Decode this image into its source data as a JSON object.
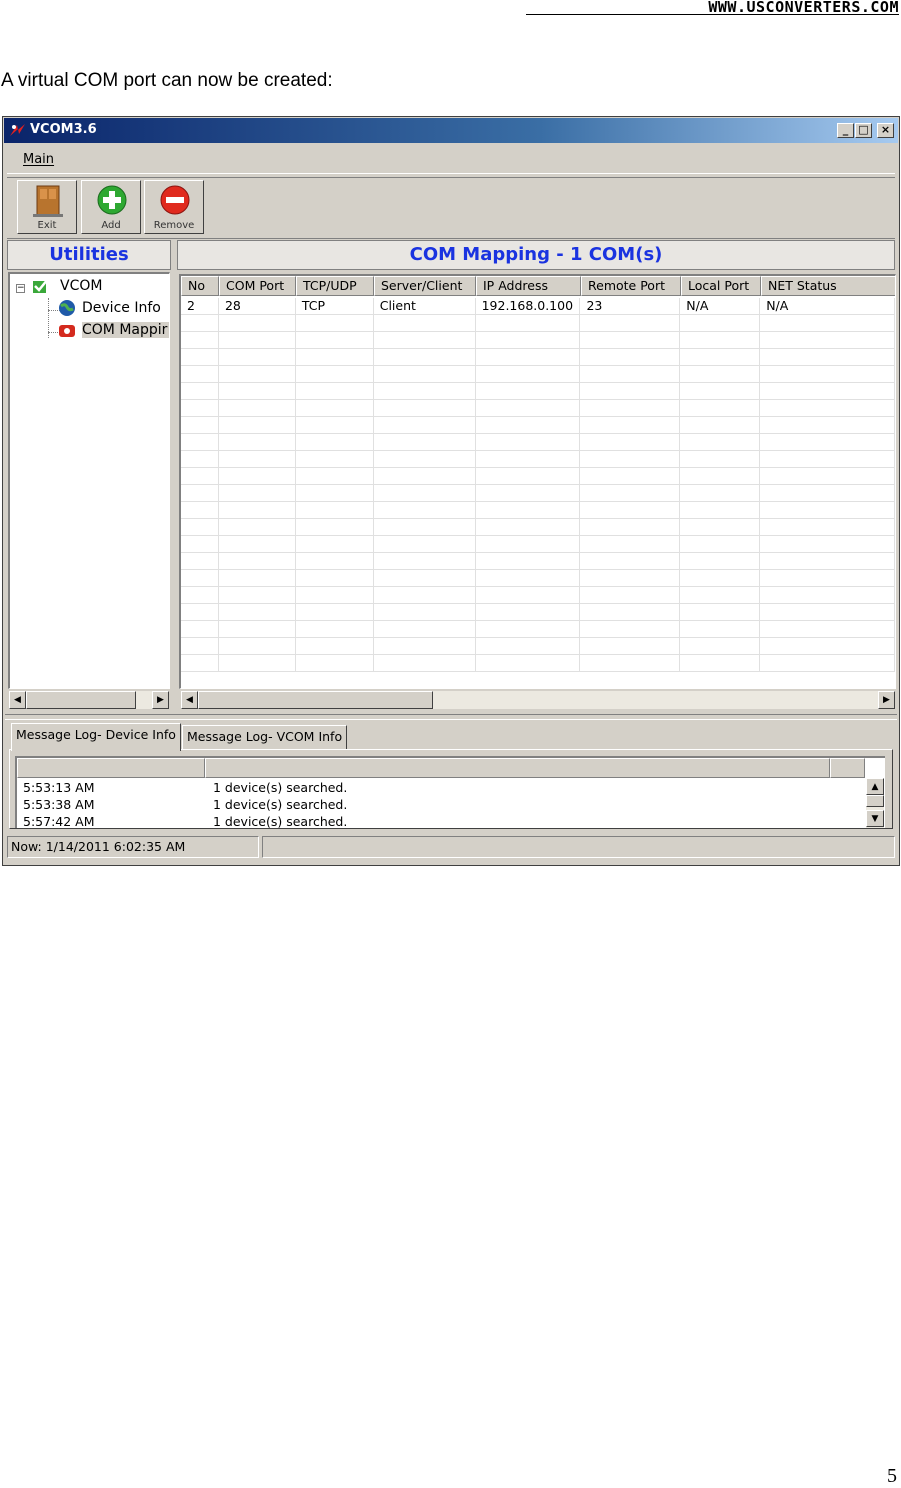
{
  "header": {
    "url": "WWW.USCONVERTERS.COM"
  },
  "intro_text": "A virtual COM port can now be created:",
  "window": {
    "title": "VCOM3.6",
    "title_buttons": {
      "minimize": "_",
      "maximize": "□",
      "close": "×"
    },
    "menu": {
      "main": "Main"
    },
    "toolbar": {
      "exit": "Exit",
      "add": "Add",
      "remove": "Remove"
    },
    "left_panel": {
      "title": "Utilities",
      "tree": {
        "root": "VCOM",
        "children": [
          "Device Info",
          "COM Mappir"
        ],
        "expander": "−"
      }
    },
    "right_panel": {
      "title": "COM Mapping - 1 COM(s)",
      "columns": [
        "No",
        "COM Port",
        "TCP/UDP",
        "Server/Client",
        "IP Address",
        "Remote Port",
        "Local Port",
        "NET Status"
      ],
      "rows": [
        [
          "2",
          "28",
          "TCP",
          "Client",
          "192.168.0.100",
          "23",
          "N/A",
          "N/A"
        ]
      ]
    },
    "tabs": [
      "Message Log- Device Info",
      "Message Log- VCOM Info"
    ],
    "log": [
      {
        "time": "5:53:13 AM",
        "message": "1 device(s) searched."
      },
      {
        "time": "5:53:38 AM",
        "message": "1 device(s) searched."
      },
      {
        "time": "5:57:42 AM",
        "message": "1 device(s) searched."
      }
    ],
    "status": {
      "now": "Now: 1/14/2011 6:02:35 AM"
    }
  },
  "page_number": "5",
  "colors": {
    "panel_title": "#1a33e0",
    "titlebar": "#0a246a",
    "window_bg": "#d4d0c8"
  }
}
